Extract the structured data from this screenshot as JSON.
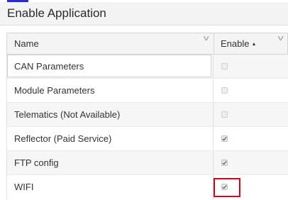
{
  "window": {
    "title": "Enable Application"
  },
  "table": {
    "columns": [
      {
        "label": "Name",
        "sort_icon": "",
        "menu_icon": "chevron-down-icon"
      },
      {
        "label": "Enable",
        "sort_icon": "▲",
        "menu_icon": "chevron-down-icon"
      }
    ],
    "rows": [
      {
        "name": "CAN Parameters",
        "enabled": false
      },
      {
        "name": "Module Parameters",
        "enabled": false
      },
      {
        "name": "Telematics (Not Available)",
        "enabled": false
      },
      {
        "name": "Reflector (Paid Service)",
        "enabled": true
      },
      {
        "name": "FTP config",
        "enabled": true
      },
      {
        "name": "WIFI",
        "enabled": true
      }
    ]
  },
  "colors": {
    "highlight": "#c2001c",
    "header_bg": "#f3f3f3",
    "row_alt": "#f6f6f6"
  }
}
